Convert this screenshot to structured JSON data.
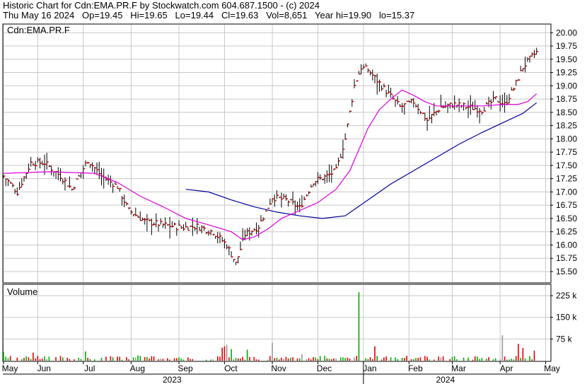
{
  "header": {
    "line1": "Historic Chart for Cdn:EMA.PR.F by Stockwatch.com 604.687.1500 - (c) 2024",
    "line2": "Thu May 16 2024   Op=19.45   Hi=19.65   Lo=19.44   Cl=19.63   Vol=8,651   Year hi=19.90   lo=15.37"
  },
  "colors": {
    "price_bar": "#000000",
    "close_tick": "#cc0000",
    "ma_short": "#dd00dd",
    "ma_long": "#000099",
    "grid": "#c8c8c8",
    "vol_up": "#00aa00",
    "vol_down": "#dd0000",
    "vol_flat": "#999999"
  },
  "chart_data": {
    "type": "bar",
    "panels": [
      {
        "name": "price",
        "label": "Cdn:EMA.PR.F",
        "ylim": [
          15.3,
          20.15
        ],
        "y_ticks": [
          "20.00",
          "19.75",
          "19.50",
          "19.25",
          "19.00",
          "18.75",
          "18.50",
          "18.25",
          "18.00",
          "17.75",
          "17.50",
          "17.25",
          "17.00",
          "16.75",
          "16.50",
          "16.25",
          "16.00",
          "15.75",
          "15.50"
        ],
        "ohlc_keypoints": [
          {
            "x": 0,
            "close": 17.3
          },
          {
            "x": 6,
            "close": 17.0
          },
          {
            "x": 12,
            "close": 17.55
          },
          {
            "x": 18,
            "close": 17.55
          },
          {
            "x": 25,
            "close": 17.3
          },
          {
            "x": 30,
            "close": 17.05
          },
          {
            "x": 37,
            "close": 17.6
          },
          {
            "x": 43,
            "close": 17.3
          },
          {
            "x": 50,
            "close": 17.1
          },
          {
            "x": 55,
            "close": 16.65
          },
          {
            "x": 62,
            "close": 16.45
          },
          {
            "x": 70,
            "close": 16.38
          },
          {
            "x": 78,
            "close": 16.33
          },
          {
            "x": 85,
            "close": 16.35
          },
          {
            "x": 92,
            "close": 16.25
          },
          {
            "x": 98,
            "close": 16.0
          },
          {
            "x": 102,
            "close": 15.65
          },
          {
            "x": 106,
            "close": 16.2
          },
          {
            "x": 112,
            "close": 16.35
          },
          {
            "x": 118,
            "close": 16.9
          },
          {
            "x": 124,
            "close": 16.85
          },
          {
            "x": 130,
            "close": 16.7
          },
          {
            "x": 136,
            "close": 17.2
          },
          {
            "x": 142,
            "close": 17.3
          },
          {
            "x": 146,
            "close": 17.4
          },
          {
            "x": 150,
            "close": 18.0
          },
          {
            "x": 154,
            "close": 19.0
          },
          {
            "x": 157,
            "close": 19.35
          },
          {
            "x": 160,
            "close": 19.3
          },
          {
            "x": 164,
            "close": 19.1
          },
          {
            "x": 168,
            "close": 18.9
          },
          {
            "x": 174,
            "close": 18.6
          },
          {
            "x": 180,
            "close": 18.7
          },
          {
            "x": 186,
            "close": 18.35
          },
          {
            "x": 192,
            "close": 18.6
          },
          {
            "x": 198,
            "close": 18.65
          },
          {
            "x": 204,
            "close": 18.6
          },
          {
            "x": 210,
            "close": 18.55
          },
          {
            "x": 216,
            "close": 18.75
          },
          {
            "x": 220,
            "close": 18.65
          },
          {
            "x": 224,
            "close": 18.95
          },
          {
            "x": 228,
            "close": 19.35
          },
          {
            "x": 232,
            "close": 19.55
          },
          {
            "x": 234,
            "close": 19.63
          }
        ],
        "series": [
          {
            "points": [
              {
                "x": 0,
                "y": 17.35
              },
              {
                "x": 20,
                "y": 17.38
              },
              {
                "x": 40,
                "y": 17.35
              },
              {
                "x": 50,
                "y": 17.18
              },
              {
                "x": 60,
                "y": 16.92
              },
              {
                "x": 70,
                "y": 16.72
              },
              {
                "x": 80,
                "y": 16.5
              },
              {
                "x": 90,
                "y": 16.38
              },
              {
                "x": 100,
                "y": 16.25
              },
              {
                "x": 105,
                "y": 16.1
              },
              {
                "x": 110,
                "y": 16.15
              },
              {
                "x": 116,
                "y": 16.3
              },
              {
                "x": 122,
                "y": 16.5
              },
              {
                "x": 130,
                "y": 16.65
              },
              {
                "x": 138,
                "y": 16.8
              },
              {
                "x": 146,
                "y": 17.05
              },
              {
                "x": 152,
                "y": 17.4
              },
              {
                "x": 156,
                "y": 17.8
              },
              {
                "x": 160,
                "y": 18.2
              },
              {
                "x": 165,
                "y": 18.55
              },
              {
                "x": 170,
                "y": 18.75
              },
              {
                "x": 175,
                "y": 18.92
              },
              {
                "x": 180,
                "y": 18.82
              },
              {
                "x": 185,
                "y": 18.7
              },
              {
                "x": 190,
                "y": 18.62
              },
              {
                "x": 200,
                "y": 18.62
              },
              {
                "x": 210,
                "y": 18.62
              },
              {
                "x": 220,
                "y": 18.65
              },
              {
                "x": 226,
                "y": 18.65
              },
              {
                "x": 230,
                "y": 18.7
              },
              {
                "x": 234,
                "y": 18.85
              }
            ]
          },
          {
            "points": [
              {
                "x": 80,
                "y": 17.05
              },
              {
                "x": 90,
                "y": 17.0
              },
              {
                "x": 100,
                "y": 16.85
              },
              {
                "x": 110,
                "y": 16.72
              },
              {
                "x": 120,
                "y": 16.62
              },
              {
                "x": 130,
                "y": 16.55
              },
              {
                "x": 140,
                "y": 16.5
              },
              {
                "x": 150,
                "y": 16.55
              },
              {
                "x": 160,
                "y": 16.85
              },
              {
                "x": 170,
                "y": 17.15
              },
              {
                "x": 180,
                "y": 17.4
              },
              {
                "x": 190,
                "y": 17.65
              },
              {
                "x": 200,
                "y": 17.9
              },
              {
                "x": 210,
                "y": 18.12
              },
              {
                "x": 220,
                "y": 18.32
              },
              {
                "x": 228,
                "y": 18.48
              },
              {
                "x": 234,
                "y": 18.68
              }
            ]
          }
        ]
      },
      {
        "name": "volume",
        "label": "Volume",
        "ylim": [
          0,
          262000
        ],
        "y_ticks": [
          "225 k",
          "150 k",
          "75 k"
        ],
        "tick_values": [
          225000,
          150000,
          75000
        ],
        "spikes": [
          {
            "x": 0,
            "v": 30000
          },
          {
            "x": 13,
            "v": 28000
          },
          {
            "x": 36,
            "v": 32000
          },
          {
            "x": 59,
            "v": 18000
          },
          {
            "x": 96,
            "v": 45000
          },
          {
            "x": 97,
            "v": 50000
          },
          {
            "x": 98,
            "v": 55000
          },
          {
            "x": 100,
            "v": 40000
          },
          {
            "x": 107,
            "v": 38000
          },
          {
            "x": 118,
            "v": 62000
          },
          {
            "x": 131,
            "v": 22000
          },
          {
            "x": 156,
            "v": 237000
          },
          {
            "x": 163,
            "v": 50000
          },
          {
            "x": 219,
            "v": 88000
          },
          {
            "x": 226,
            "v": 58000
          },
          {
            "x": 228,
            "v": 44000
          },
          {
            "x": 233,
            "v": 35000
          }
        ]
      }
    ],
    "x_axis": {
      "domain": [
        0,
        240
      ],
      "month_labels": [
        {
          "label": "May",
          "x": 0
        },
        {
          "label": "Jun",
          "x": 15
        },
        {
          "label": "Jul",
          "x": 35
        },
        {
          "label": "Aug",
          "x": 56
        },
        {
          "label": "Sep",
          "x": 77
        },
        {
          "label": "Oct",
          "x": 97
        },
        {
          "label": "Nov",
          "x": 118
        },
        {
          "label": "Dec",
          "x": 138
        },
        {
          "label": "Jan",
          "x": 158
        },
        {
          "label": "Feb",
          "x": 178
        },
        {
          "label": "Mar",
          "x": 197
        },
        {
          "label": "Apr",
          "x": 218
        },
        {
          "label": "May",
          "x": 238
        }
      ],
      "years": [
        {
          "label": "2023",
          "x": 74
        },
        {
          "label": "2024",
          "x": 194
        }
      ]
    }
  }
}
